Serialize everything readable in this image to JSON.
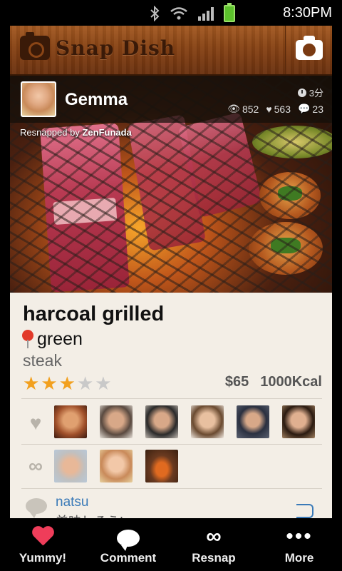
{
  "status_bar": {
    "time": "8:30PM"
  },
  "header": {
    "app_name": "Snap Dish"
  },
  "post": {
    "username": "Gemma",
    "time_ago": "3分",
    "views": "852",
    "likes": "563",
    "comments": "23",
    "resnapped_prefix": "Resnapped by ",
    "resnapped_user": "ZenFunada",
    "title": "harcoal grilled",
    "location": "green",
    "subtitle": "steak",
    "rating": 3,
    "rating_max": 5,
    "price": "$65",
    "calories": "1000Kcal"
  },
  "likers_count": 6,
  "resnappers_count": 3,
  "latest_comment": {
    "user": "natsu",
    "text": "美味しそう!"
  },
  "bottom_nav": [
    {
      "label": "Yummy!",
      "icon": "heart-icon"
    },
    {
      "label": "Comment",
      "icon": "comment-icon"
    },
    {
      "label": "Resnap",
      "icon": "infinity-icon"
    },
    {
      "label": "More",
      "icon": "more-dots-icon"
    }
  ],
  "colors": {
    "accent_heart": "#ef3d5a",
    "star_on": "#f2a01e",
    "star_off": "#c9c9c9",
    "link_blue": "#3a7ab8",
    "header_wood": "#8a4516"
  }
}
